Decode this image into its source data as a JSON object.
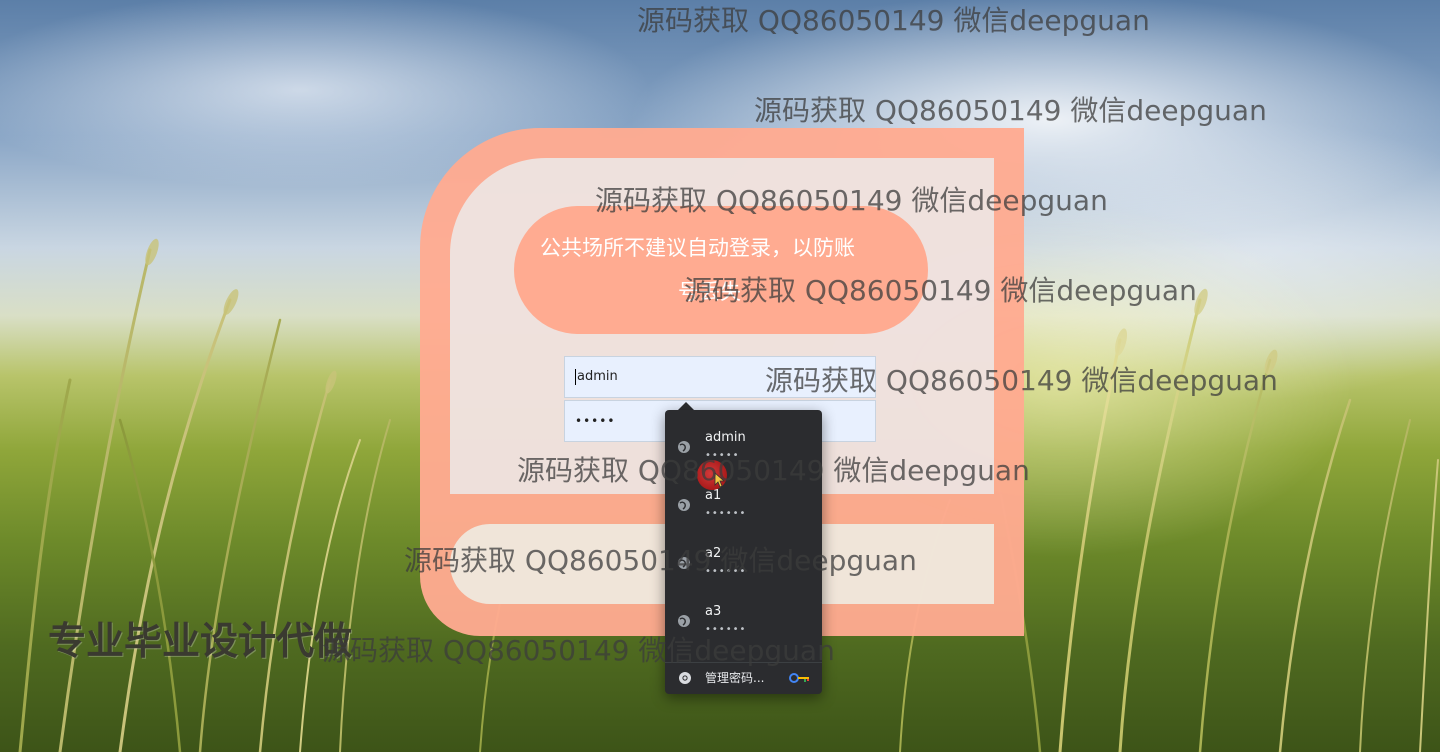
{
  "login_form": {
    "notice": {
      "line1": "公共场所不建议自动登录，以防账",
      "line2": "号丢失"
    },
    "username_value": "admin",
    "password_mask": "•••••"
  },
  "autofill_dropdown": {
    "items": [
      {
        "username": "admin",
        "password_mask": "•••••"
      },
      {
        "username": "a1",
        "password_mask": "••••••"
      },
      {
        "username": "a2",
        "password_mask": "••••••"
      },
      {
        "username": "a3",
        "password_mask": "••••••"
      }
    ],
    "manage_label": "管理密码..."
  },
  "promo_text": "专业毕业设计代做",
  "watermarks": [
    "源码获取 QQ86050149 微信deepguan",
    "源码获取 QQ86050149 微信deepguan",
    "源码获取 QQ86050149 微信deepguan",
    "源码获取 QQ86050149 微信deepguan",
    "源码获取 QQ86050149 微信deepguan",
    "源码获取 QQ86050149 微信deepguan",
    "源码获取 QQ86050149 微信deepguan",
    "源码获取 QQ86050149 微信deepguan"
  ],
  "colors": {
    "frame_salmon": "#ffab91",
    "autofill_bg": "#2b2c2f",
    "field_bg": "#e8f0fe"
  },
  "icons": [
    "globe-icon",
    "chrome-icon",
    "key-icon",
    "cursor-icon"
  ]
}
